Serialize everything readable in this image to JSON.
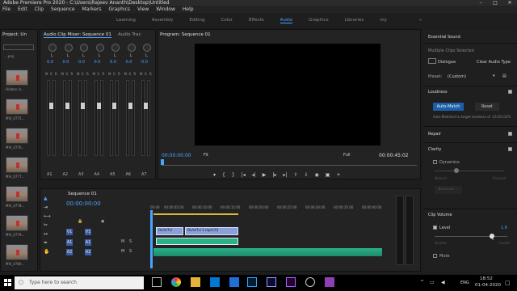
{
  "titlebar": {
    "text": "Adobe Premiere Pro 2020 - C:\\Users\\Rajeev Ananth\\Desktop\\Untitled"
  },
  "menu": [
    "File",
    "Edit",
    "Clip",
    "Sequence",
    "Markers",
    "Graphics",
    "View",
    "Window",
    "Help"
  ],
  "workspaces": [
    "Learning",
    "Assembly",
    "Editing",
    "Color",
    "Effects",
    "Audio",
    "Graphics",
    "Libraries",
    "my"
  ],
  "active_workspace": "Audio",
  "project": {
    "tab": "Project: Un",
    "label": "...proj",
    "items": [
      "Hidden in...",
      "MVI_0775...",
      "MVI_0776...",
      "MVI_0777...",
      "MVI_0778...",
      "MVI_0779...",
      "MVI_0780..."
    ]
  },
  "mixer": {
    "tab": "Audio Clip Mixer: Sequence 01",
    "tab2": "Audio Trac",
    "channels": [
      "A1",
      "A2",
      "A3",
      "A4",
      "A5",
      "A6",
      "A7"
    ],
    "channel_names": [
      "Audio",
      "Audio",
      "Audio",
      "Audio",
      "Audio",
      "Audio",
      "Audio"
    ],
    "l_labels": [
      "L",
      "L",
      "L",
      "L",
      "L",
      "L",
      "L"
    ],
    "value": "0.0"
  },
  "program": {
    "tab": "Program: Sequence 01",
    "timecode": "00:00:00:00",
    "fit": "Fit",
    "full": "Full",
    "duration": "00:00:45:02"
  },
  "timeline": {
    "tab": "Sequence 01",
    "timecode": "00:00:00:00",
    "ruler": [
      "00:00",
      "00:00:05:00",
      "00:00:10:00",
      "00:00:15:00",
      "00:00:20:00",
      "00:00:25:00",
      "00:00:30:00",
      "00:00:35:00",
      "00:00:40:00"
    ],
    "tracks": [
      "V1",
      "A1",
      "A2"
    ],
    "clips": [
      "Ov/nt7vi",
      "Ov/nt7vi 1.mp4 [V]"
    ]
  },
  "essential": {
    "tab": "Essential Sound",
    "none": "Multiple Clips Selected",
    "dialogue": "Dialogue",
    "clear": "Clear Audio Type",
    "preset_label": "Preset:",
    "preset": "(Custom)",
    "loudness": "Loudness",
    "auto_match": "Auto-Match",
    "reset": "Reset",
    "auto_note": "Auto-Matched to target loudness of -23.00 LUFS",
    "repair": "Repair",
    "clarity": "Clarity",
    "dynamics": "Dynamics",
    "natural": "Natural",
    "focused": "Focused",
    "enhance": "Enhance ...",
    "clip_volume": "Clip Volume",
    "level": "Level",
    "level_value": "1.6",
    "quieter": "Quieter",
    "louder": "Louder",
    "mute": "Mute"
  },
  "taskbar": {
    "search": "Type here to search",
    "time": "18:52",
    "date": "01-04-2020",
    "lang": "ENG"
  },
  "colors": {
    "accent": "#4aa3ff",
    "timecode": "#4aa3ff",
    "audio_clip": "#2bb08a",
    "video_clip": "#8aa0d8"
  }
}
